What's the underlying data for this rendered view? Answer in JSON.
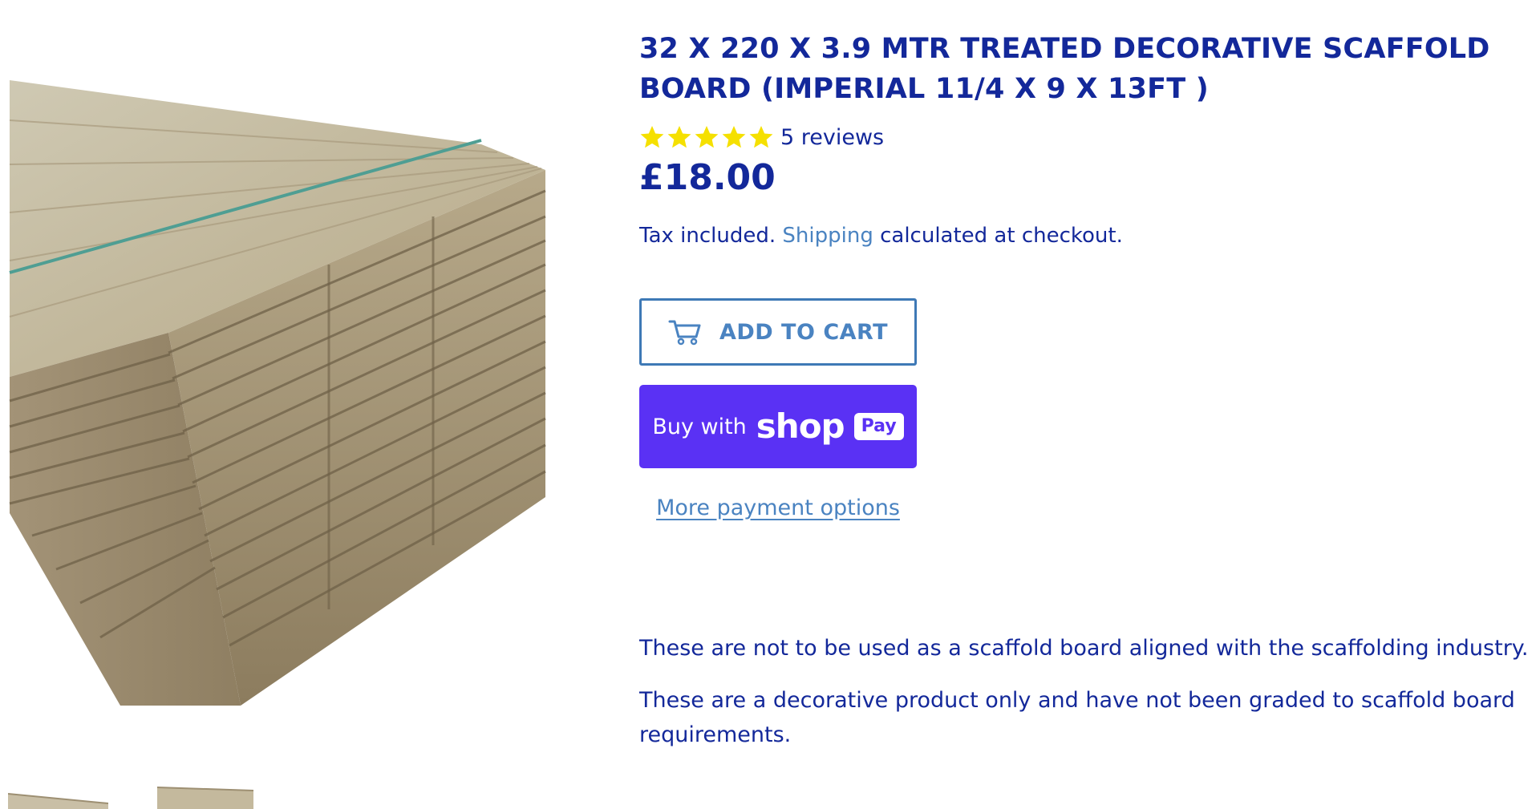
{
  "product": {
    "title": "32 X 220 X 3.9 MTR TREATED DECORATIVE SCAFFOLD BOARD (IMPERIAL 11/4 X 9 X 13FT )",
    "rating": 5,
    "reviews_label": "5 reviews",
    "price": "£18.00"
  },
  "tax_note": {
    "prefix": "Tax included.",
    "link": "Shipping",
    "suffix": "calculated at checkout."
  },
  "buttons": {
    "add_to_cart": "ADD TO CART",
    "buy_with": "Buy with",
    "shop_word": "shop",
    "pay_badge": "Pay",
    "more_payment": "More payment options"
  },
  "description": [
    "These are not to be used as a scaffold board aligned with the scaffolding industry.",
    "These are a decorative product only and have not been graded to scaffold board requirements."
  ],
  "colors": {
    "text": "#13289a",
    "link": "#4a83c1",
    "star": "#f5e000",
    "shop_pay": "#5a31f4"
  },
  "icons": [
    "star-icon",
    "cart-icon"
  ]
}
